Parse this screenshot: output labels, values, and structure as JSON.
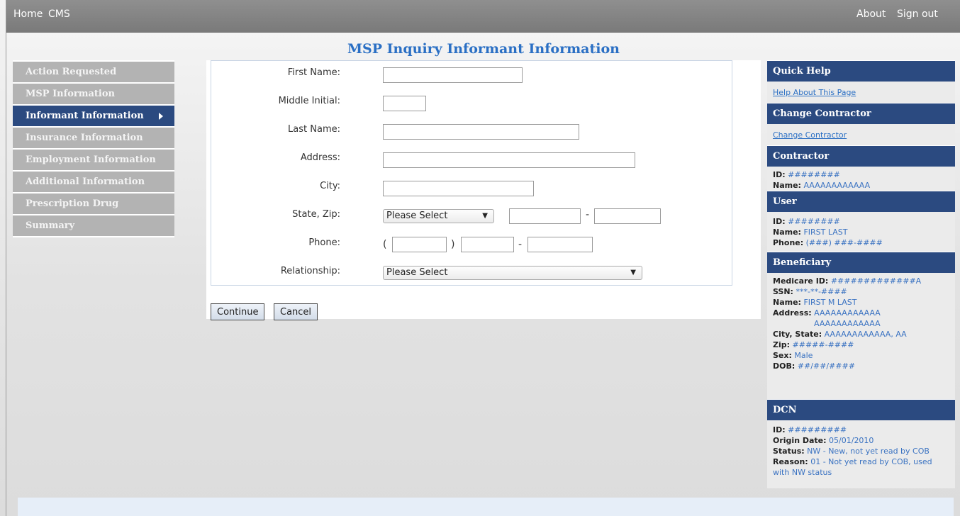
{
  "topnav": {
    "home": "Home",
    "cms": "CMS",
    "about": "About",
    "signout": "Sign out"
  },
  "page_title": "MSP Inquiry Informant Information",
  "menu": [
    {
      "label": "Action Requested"
    },
    {
      "label": "MSP Information"
    },
    {
      "label": "Informant Information"
    },
    {
      "label": "Insurance Information"
    },
    {
      "label": "Employment Information"
    },
    {
      "label": "Additional Information"
    },
    {
      "label": "Prescription Drug"
    },
    {
      "label": "Summary"
    }
  ],
  "form": {
    "first_name": {
      "label": "First Name:",
      "value": ""
    },
    "middle_initial": {
      "label": "Middle Initial:",
      "value": ""
    },
    "last_name": {
      "label": "Last Name:",
      "value": ""
    },
    "address": {
      "label": "Address:",
      "value": ""
    },
    "city": {
      "label": "City:",
      "value": ""
    },
    "state_zip": {
      "label": "State, Zip:",
      "state": "Please Select",
      "zip5": "",
      "zip4": "",
      "dash": "-"
    },
    "phone": {
      "label": "Phone:",
      "area": "",
      "prefix": "",
      "line": "",
      "open": "(",
      "close": ")",
      "dash": "-"
    },
    "relationship": {
      "label": "Relationship:",
      "value": "Please Select"
    }
  },
  "buttons": {
    "continue": "Continue",
    "cancel": "Cancel"
  },
  "right": {
    "quick_help": {
      "title": "Quick Help",
      "link": "Help About This Page"
    },
    "change_contractor": {
      "title": "Change Contractor",
      "link": "Change Contractor"
    },
    "contractor": {
      "title": "Contractor",
      "id_label": "ID:",
      "id": "########",
      "name_label": "Name:",
      "name": "AAAAAAAAAAAA"
    },
    "user": {
      "title": "User",
      "id_label": "ID:",
      "id": "########",
      "name_label": "Name:",
      "name": "FIRST LAST",
      "phone_label": "Phone:",
      "phone": "(###) ###-####"
    },
    "beneficiary": {
      "title": "Beneficiary",
      "medicare_label": "Medicare ID:",
      "medicare": "#############A",
      "ssn_label": "SSN:",
      "ssn": "***-**-####",
      "name_label": "Name:",
      "name": "FIRST M LAST",
      "address_label": "Address:",
      "address1": "AAAAAAAAAAAA",
      "address2": "AAAAAAAAAAAA",
      "city_label": "City, State:",
      "city": "AAAAAAAAAAAA, AA",
      "zip_label": "Zip:",
      "zip": "#####-####",
      "sex_label": "Sex:",
      "sex": "Male",
      "dob_label": "DOB:",
      "dob": "##/##/####"
    },
    "dcn": {
      "title": "DCN",
      "id_label": "ID:",
      "id": "#########",
      "origin_label": "Origin Date:",
      "origin": "05/01/2010",
      "status_label": "Status:",
      "status": "NW - New, not yet read by COB",
      "reason_label": "Reason:",
      "reason": "01 - Not yet read by COB, used with NW status"
    }
  }
}
